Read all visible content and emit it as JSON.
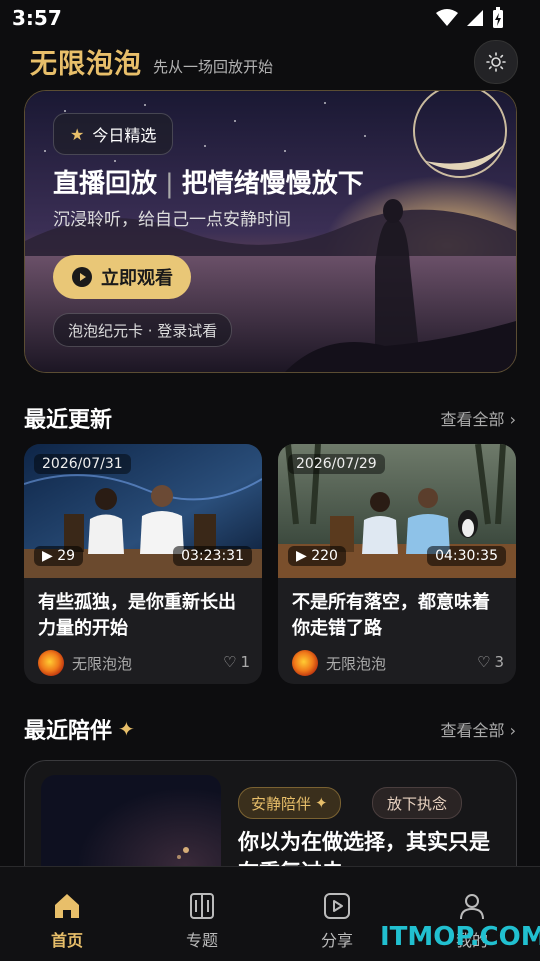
{
  "status": {
    "time": "3:57"
  },
  "header": {
    "title": "无限泡泡",
    "subtitle": "先从一场回放开始"
  },
  "hero": {
    "tag": "今日精选",
    "title_a": "直播回放",
    "title_sep": "|",
    "title_b": "把情绪慢慢放下",
    "desc": "沉浸聆听，给自己一点安静时间",
    "watch_button": "立即观看",
    "login_pill": "泡泡纪元卡 · 登录试看"
  },
  "recent": {
    "title": "最近更新",
    "more": "查看全部 ›",
    "cards": [
      {
        "date": "2026/07/31",
        "plays": "▶ 29",
        "duration": "03:23:31",
        "title": "有些孤独，是你重新长出力量的开始",
        "author": "无限泡泡",
        "likes": "1"
      },
      {
        "date": "2026/07/29",
        "plays": "▶ 220",
        "duration": "04:30:35",
        "title": "不是所有落空，都意味着你走错了路",
        "author": "无限泡泡",
        "likes": "3"
      }
    ]
  },
  "companion": {
    "title": "最近陪伴",
    "more": "查看全部 ›",
    "tag_a": "安静陪伴",
    "tag_b": "放下执念",
    "card_title": "你以为在做选择，其实只是在重复过去"
  },
  "tabs": [
    {
      "label": "首页",
      "icon": "home-icon",
      "active": true
    },
    {
      "label": "专题",
      "icon": "book-icon",
      "active": false
    },
    {
      "label": "分享",
      "icon": "play-icon",
      "active": false
    },
    {
      "label": "我的",
      "icon": "user-icon",
      "active": false
    }
  ],
  "watermark": "ITMOP.COM",
  "colors": {
    "accent": "#e8bf6a",
    "background": "#0d0d0f",
    "card": "#1d1d20"
  }
}
